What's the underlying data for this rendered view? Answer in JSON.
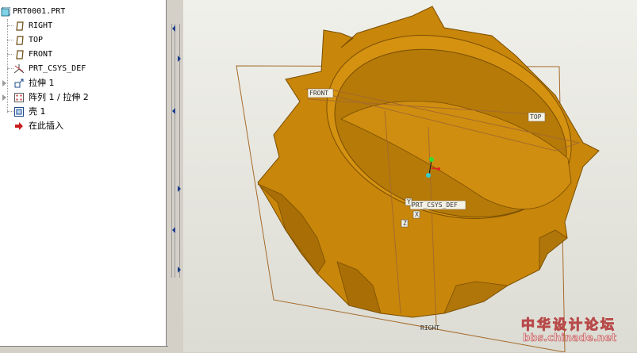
{
  "model_tree": {
    "items": [
      {
        "label": "PRT0001.PRT",
        "icon": "part-icon"
      },
      {
        "label": "RIGHT",
        "icon": "datum-plane-icon"
      },
      {
        "label": "TOP",
        "icon": "datum-plane-icon"
      },
      {
        "label": "FRONT",
        "icon": "datum-plane-icon"
      },
      {
        "label": "PRT_CSYS_DEF",
        "icon": "csys-icon"
      },
      {
        "label": "拉伸 1",
        "icon": "extrude-icon"
      },
      {
        "label": "阵列 1 / 拉伸 2",
        "icon": "pattern-icon"
      },
      {
        "label": "壳 1",
        "icon": "shell-icon"
      },
      {
        "label": "在此插入",
        "icon": "insert-here-arrow-icon"
      }
    ]
  },
  "viewport": {
    "plane_labels": {
      "front": "FRONT",
      "top": "TOP",
      "right": "RIGHT",
      "csys": "PRT_CSYS_DEF"
    },
    "axis_labels": {
      "x": "X",
      "y": "Y",
      "z": "Z"
    },
    "model_color": "#c8860a",
    "background_color": "#e6e6df"
  },
  "watermark": {
    "line1": "中华设计论坛",
    "line2": "bbs.chinade.net"
  }
}
